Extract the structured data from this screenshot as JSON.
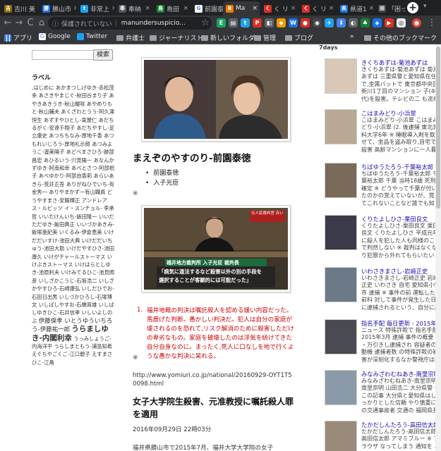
{
  "tabs": [
    {
      "label": "吉川 美",
      "color": "#8e6b00",
      "glyph": "吉"
    },
    {
      "label": "勝山市",
      "color": "#1a73e8",
      "glyph": "勝"
    },
    {
      "label": "非常上",
      "color": "#1da1f2",
      "glyph": "t"
    },
    {
      "label": "奉納",
      "color": "#555555",
      "glyph": "奉"
    },
    {
      "label": "島田",
      "color": "#188038",
      "glyph": "島"
    },
    {
      "label": "前園泰",
      "color": "#ffffff",
      "glyph": "G"
    },
    {
      "label": "Ma",
      "color": "#f57c00",
      "glyph": "B",
      "active": true
    },
    {
      "label": "く リ",
      "color": "#d93025",
      "glyph": "く"
    },
    {
      "label": "く リ",
      "color": "#d93025",
      "glyph": "く"
    },
    {
      "label": "県道1",
      "color": "#1a73e8",
      "glyph": "県"
    },
    {
      "label": "「困っ",
      "color": "#3c4043",
      "glyph": "困"
    }
  ],
  "toolbar": {
    "back": "←",
    "forward": "→",
    "reload": "C",
    "home": "⌂",
    "security_text": "保護されていない",
    "url_host": "manundersuspicio...",
    "star": "☆"
  },
  "bookmarks": {
    "apps": "アプリ",
    "google": "Google",
    "twitter": "Twitter",
    "bengoshi": "弁護士",
    "journalist": "ジャーナリスト",
    "new_folder": "新しいフォルダ",
    "kanri": "管理",
    "blog": "ブログ",
    "more": "»",
    "other": "その他のブックマーク"
  },
  "sidebar": {
    "search_button": "検索",
    "label_heading": "ラベル",
    "cloud_text": ",はじめに あかまつしげゆき-赤松茂幸 あさきやまじぐ-秋田谷まり子 あやきあきうき-秋山耀咲 あやめりもと-秋山輔夫 あくざわとうう-阿久澤恒生 あずすやひとし-東屋仁 あだちるがく-安達千翔子 あだちやすし-足立康史 あつちちなみ-厚地千香 あつもれいじろう-厚地礼示郎 あつみようこ-渥美陽子 あどべまさひろ-跡部昌宏 あひるいう-穴見陽一 あなんかずゆき-阿南和幸 あべとさつ-阿部祝子 あべゆかり-阿部由香莉 あらいあきら-荒井正吾 ありがねひでいち-有金秀一 ありやまかずー有山職員 どうやすまさ-安藤輝正 アンドレアス・ルビッツ イ・スンチョル- 李承哲 いいたけんいち-飯田隆一 いいだただゆき-飯田典正 いいづかあきみ-飯塚亜紀美 いくるみ-伊倉恵美 いけだだいすけ-池田大典 いけだだいちゅう-池田大助 いけだやすひさ-池田康久 いけがチャールストーマス いけぶきストーマス いけはらとしゆき-池原利夫 いけみてるひこ-池見照彦 いしざかこうじ-石坂浩二 いしざかやすひろ-石崎康弘 いしだひでお-石田日出男 いしづかひろし-石塚博文 いしぱしやすお-石橋育雄 いしばしゆきひこ-石井信孝 いしいよしのぶ",
    "cloud_big": "うらましゆき-内閣利幸",
    "cloud_tail": "うっみしょうご-内海洋平 うらしまともう-浦島知希 えぐちやごくご-江口碧子 えすまさひこ-江角",
    "cloud_mid": "伊藤保孝 いとうゆういちろう-伊藤祐一郎"
  },
  "main": {
    "post_title": "まえぞのやすのり-前園泰徳",
    "tags": [
      "前園泰徳",
      "入子光臣"
    ],
    "mark": "※",
    "banner": {
      "top_label": "元人民裁判官 赤い",
      "line1": "福井地方裁判所 入子光臣 裁判長",
      "line2": "「病気に違法するなど殺害以外の別の手段を",
      "line3": "選択することが客観的には可能だった」"
    },
    "note_num": "1.",
    "note": "福井地裁の判決は嘱託殺人を認める緩い内容だった。馬鹿げた判断。愚かしい判決だ。犯人は自分の家庭が壊されるのを恐れて,リスク解消のために殺害しただけの卑劣なもの。家庭を破壊したのは浮気を続けてきた自分自身なのに。まったく,死人に口なしを地で行くような愚かな判決に呆れる。",
    "source_url": "http://www.yomiuri.co.jp/national/20160929-OYT1T50098.html",
    "article_title": "女子大学院生殺害、元准教授に嘱託殺人罪を適用",
    "article_date": "2016年09月29日 22時03分",
    "article_body": "福井県勝山市で2015年7月、福井大学大学院の女子"
  },
  "right": {
    "days_label": "7days",
    "items": [
      {
        "title": "きくちあずは-菊池あずは",
        "text": "きくちあずは-菊池あずは 菊池あずは 三重県警と愛知県在住で,金属バットで 東京都中央区新川1丁目のマンション 子(40代)を殺害。テレビの二 も流れていますが凄惨な現場だったようです。※ http://www.asahi.com...",
        "thumb": "#d9c7b8"
      },
      {
        "title": "こはまみどり-小浜翠",
        "text": "こはまみどり-小浜翠 こはまみどり-小浜翠 (2. 後逮捕 東北楽料大学6年 ※ 睡眠導入剤を飲ませて、金品を盗み取り,自宅で殺害 高齢マンションに一人暮らしの老女を殺害する手段で 事件で逮捕されていたのか。犯罪は一種だから常習化していたのだろう。思の成功例...",
        "thumb": "#b9a893"
      },
      {
        "title": "ちばゆうたろう-千葉裕太郎",
        "text": "ちばゆうたろう-千葉裕太郎 千葉裕太郎 千葉 当時18歳 死刑確定 ※ どうやって千葉が付いたのかの覚えていないが、覚えてこれないことなど誰でも知っていることだ。被告人は自分がしたことが殺人だから覚えていないことに違いない。言う年齢も関係ないことだ。※ http:/...",
        "thumb": "#7a6a5a"
      },
      {
        "title": "くりたよしひさ-栗田良文",
        "text": "くりたよしひさ-栗田良文 栗田良文 くりたよしひさ 平成元年に殺人を犯した人も同様のことで判然しない ※ 裁判はなくなり犯罪から外れてもらいたいとして本当に許しがたいのではないか。※ http://mainichi.jp/articles/20160919...",
        "thumb": "#3a3a4a"
      },
      {
        "title": "いわさきまさし-岩崎正史",
        "text": "いわさきまさし-岩崎正史 岩崎正史 いわさき 自宅 愛知県小牧市 逮捕 ※ 事件の前 運転した。前科 対して事件が発生した日に逮捕されるという、自分に腹を立てたことから事件を起こし,ミスが取り値するほど。※ ht...",
        "thumb": "#6b7a86"
      },
      {
        "title": "指名手配 毎日更新 - 2015年3月",
        "text": "ニュース 特殊詐欺で 指名手配 2015年3月 逮捕 事件の概要 ・万引きし逮捕され 容疑者の動機 逮捕者数 の特殊詐欺の被害が深刻化するなか警視庁は指名手配の容疑者の自宅を(2014)に関わったとして自首で... ※ 指名手配し 動画 ※ ...",
        "thumb": "#4a4a52"
      },
      {
        "title": "みなみざわむねあき-南里宗明",
        "text": "みなみざわむねあき-南里宗明 南里宗明 山田浩二 大分県警 ※ この記事 大分県と愛知県はしっかりとした信頼 やり慎重に の交通事故者 交通の 福岡県長 作二つ 庁と大阪府警の連携で悪く,山田浩二をそのまま 被害を未然に防ぐこ...",
        "thumb": "#8a9aa8"
      },
      {
        "title": "たかだしんたろう-高田信太郎",
        "text": "たかだしんたろう-高田信太郎 高田信太郎 アマミブルー ※ プラウザ なってしまう 通知を ...",
        "thumb": "#9a8a7a"
      }
    ]
  }
}
